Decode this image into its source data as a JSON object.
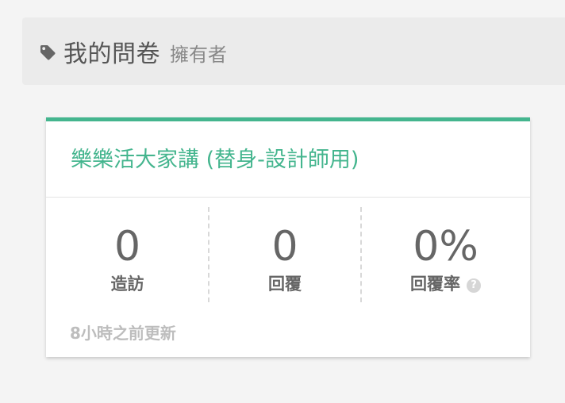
{
  "header": {
    "icon": "tag-icon",
    "title": "我的問卷",
    "subtitle": "擁有者"
  },
  "survey": {
    "title": "樂樂活大家講 (替身-設計師用)",
    "accent_color": "#44b58e",
    "stats": [
      {
        "value": "0",
        "label": "造訪"
      },
      {
        "value": "0",
        "label": "回覆"
      },
      {
        "value": "0%",
        "label": "回覆率",
        "help_icon": "question-circle-icon",
        "help_glyph": "?"
      }
    ],
    "updated": "8小時之前更新"
  }
}
